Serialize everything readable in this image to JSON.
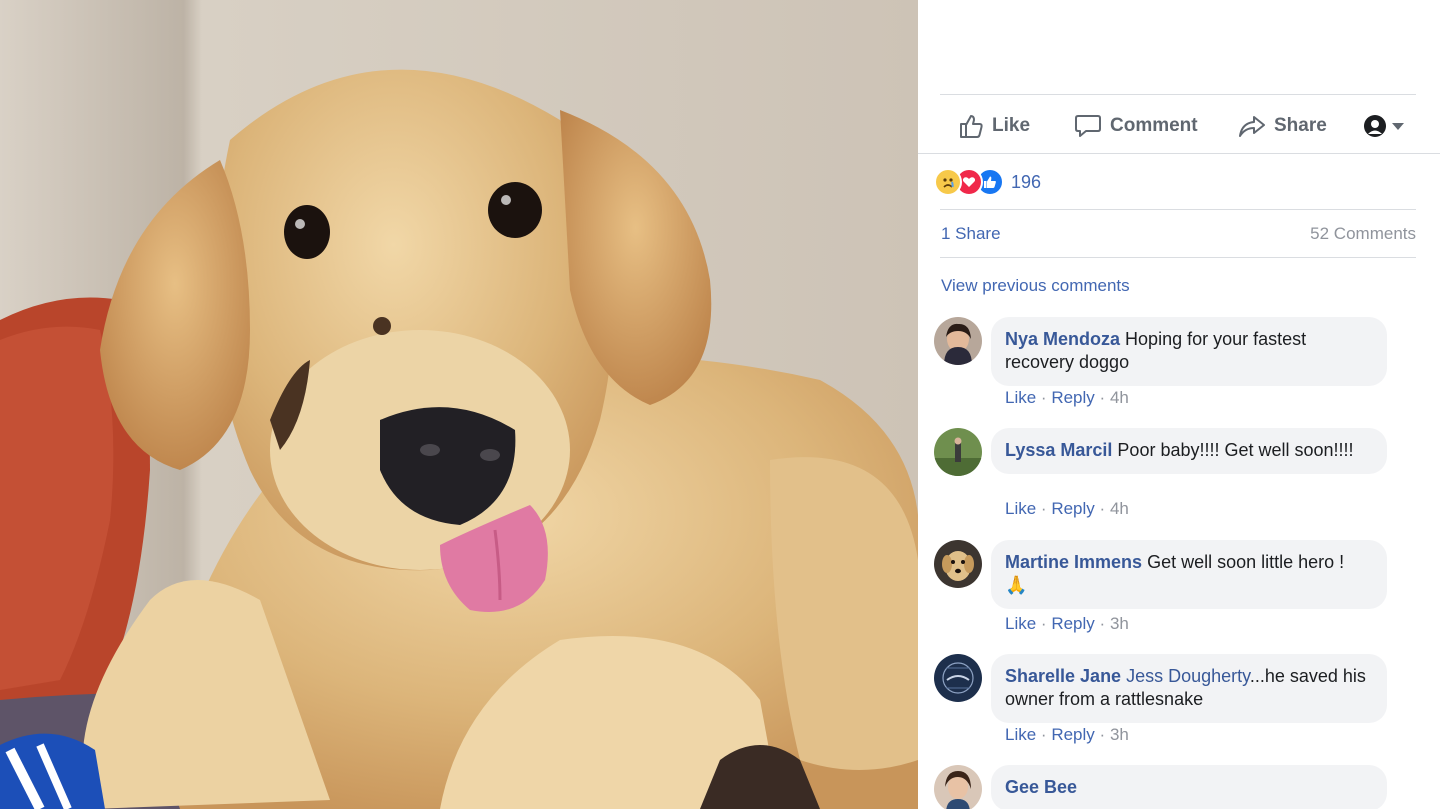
{
  "post_actions": {
    "like_label": "Like",
    "comment_label": "Comment",
    "share_label": "Share"
  },
  "reactions": {
    "icons": [
      "sad-icon",
      "love-icon",
      "like-icon"
    ],
    "count": "196"
  },
  "stats": {
    "shares": "1 Share",
    "comments": "52 Comments"
  },
  "view_previous": "View previous comments",
  "comments": [
    {
      "author": "Nya Mendoza",
      "text": "Hoping for your fastest recovery doggo",
      "like": "Like",
      "sep": "·",
      "reply": "Reply",
      "time": "4h"
    },
    {
      "author": "Lyssa Marcil",
      "text": "Poor baby!!!! Get well soon!!!!",
      "like": "Like",
      "sep": "·",
      "reply": "Reply",
      "time": "4h"
    },
    {
      "author": "Martine Immens",
      "text": "Get well soon little hero !",
      "emoji": "🙏",
      "like": "Like",
      "sep": "·",
      "reply": "Reply",
      "time": "3h"
    },
    {
      "author": "Sharelle Jane",
      "tag": "Jess Dougherty",
      "text": "...he saved his owner from a rattlesnake",
      "like": "Like",
      "sep": "·",
      "reply": "Reply",
      "time": "3h"
    },
    {
      "author": "Gee Bee"
    }
  ],
  "colors": {
    "link": "#4267b2",
    "author": "#385898",
    "muted": "#90949c",
    "bubble": "#f2f3f5"
  }
}
